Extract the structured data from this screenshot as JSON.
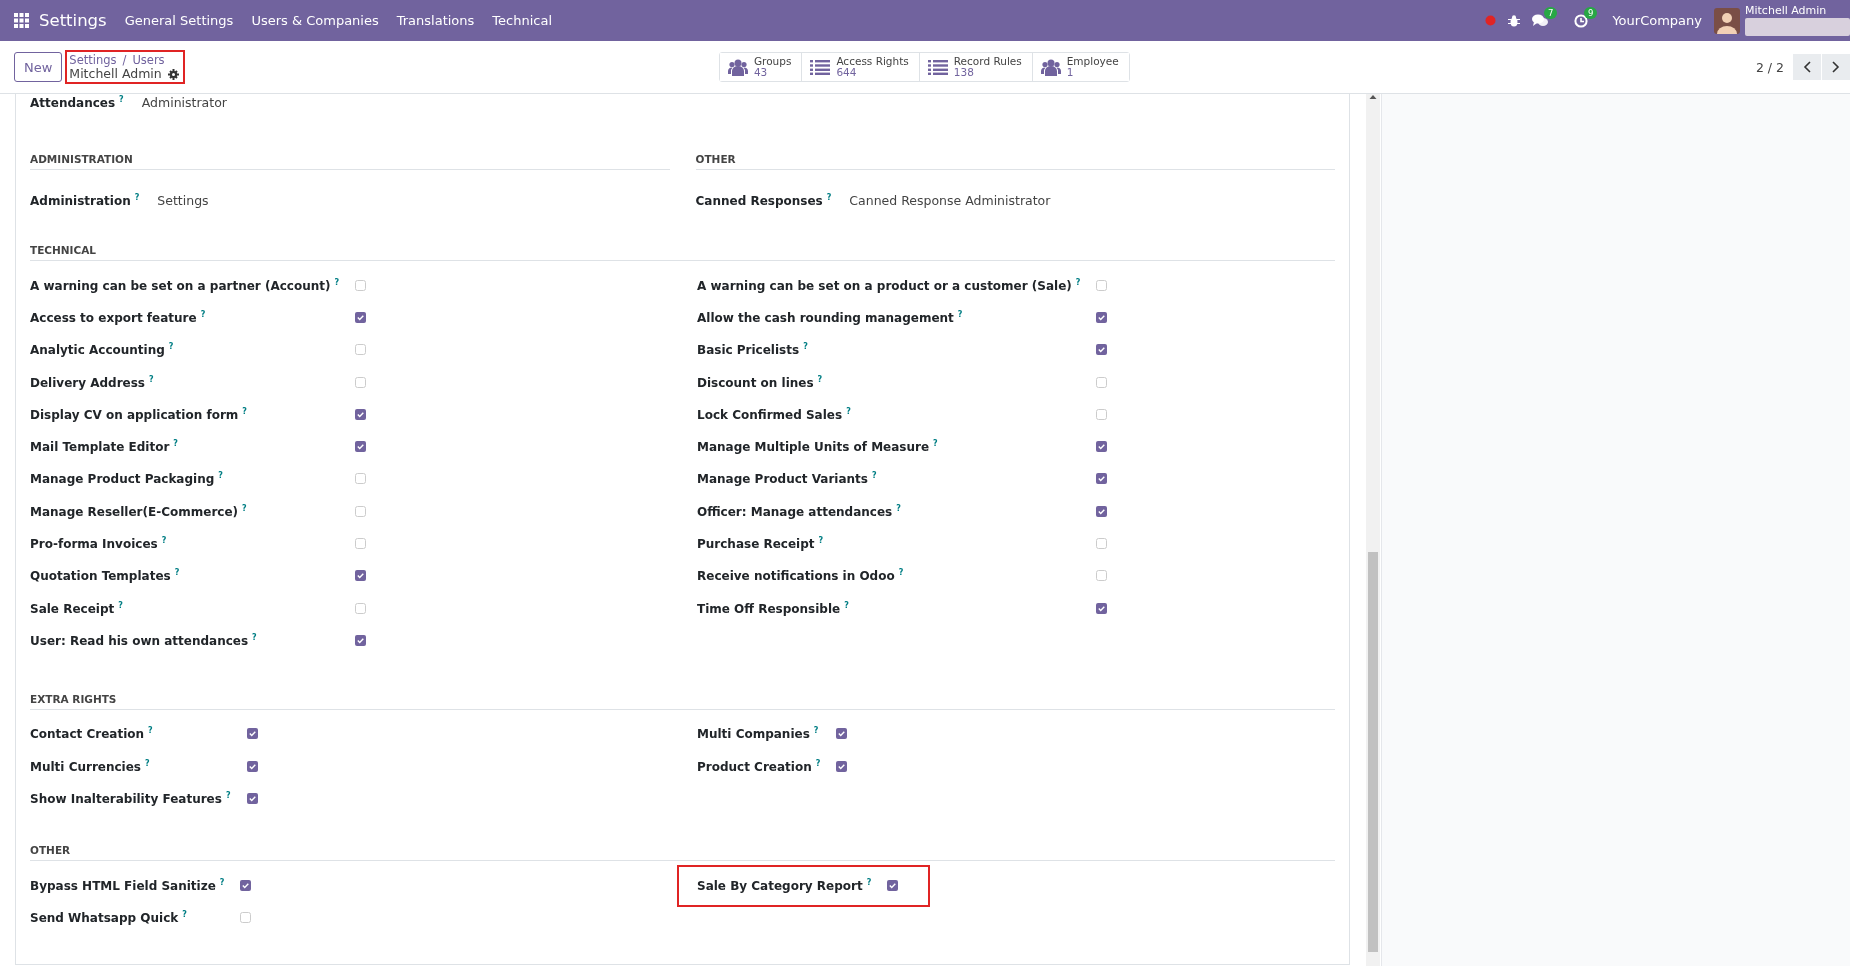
{
  "navbar": {
    "app": "Settings",
    "menus": [
      "General Settings",
      "Users & Companies",
      "Translations",
      "Technical"
    ],
    "chat_badge": "7",
    "activity_badge": "9",
    "company": "YourCompany",
    "user": "Mitchell Admin"
  },
  "control_panel": {
    "new_button": "New",
    "breadcrumb": [
      "Settings",
      "Users"
    ],
    "breadcrumb_separator": "/",
    "current": "Mitchell Admin",
    "highlighted": true,
    "smart_buttons": [
      {
        "kind": "users",
        "label": "Groups",
        "value": "43"
      },
      {
        "kind": "list",
        "label": "Access Rights",
        "value": "644"
      },
      {
        "kind": "list",
        "label": "Record Rules",
        "value": "138"
      },
      {
        "kind": "users",
        "label": "Employee",
        "value": "1"
      }
    ],
    "pager": "2 / 2"
  },
  "top_field": {
    "label": "Attendances",
    "help": "?",
    "value": "Administrator"
  },
  "blocks": [
    {
      "kind": "split",
      "sections": [
        {
          "title": "ADMINISTRATION",
          "fields": [
            {
              "label": "Administration",
              "help": "?",
              "value": "Settings"
            }
          ]
        },
        {
          "title": "OTHER",
          "fields": [
            {
              "label": "Canned Responses",
              "help": "?",
              "value": "Canned Response Administrator"
            }
          ]
        }
      ]
    },
    {
      "kind": "checks",
      "title": "TECHNICAL",
      "columns": [
        [
          {
            "label": "A warning can be set on a partner (Account)",
            "help": "?",
            "checked": false
          },
          {
            "label": "Access to export feature",
            "help": "?",
            "checked": true
          },
          {
            "label": "Analytic Accounting",
            "help": "?",
            "checked": false
          },
          {
            "label": "Delivery Address",
            "help": "?",
            "checked": false
          },
          {
            "label": "Display CV on application form",
            "help": "?",
            "checked": true
          },
          {
            "label": "Mail Template Editor",
            "help": "?",
            "checked": true
          },
          {
            "label": "Manage Product Packaging",
            "help": "?",
            "checked": false
          },
          {
            "label": "Manage Reseller(E-Commerce)",
            "help": "?",
            "checked": false
          },
          {
            "label": "Pro-forma Invoices",
            "help": "?",
            "checked": false
          },
          {
            "label": "Quotation Templates",
            "help": "?",
            "checked": true
          },
          {
            "label": "Sale Receipt",
            "help": "?",
            "checked": false
          },
          {
            "label": "User: Read his own attendances",
            "help": "?",
            "checked": true
          }
        ],
        [
          {
            "label": "A warning can be set on a product or a customer (Sale)",
            "help": "?",
            "checked": false
          },
          {
            "label": "Allow the cash rounding management",
            "help": "?",
            "checked": true
          },
          {
            "label": "Basic Pricelists",
            "help": "?",
            "checked": true
          },
          {
            "label": "Discount on lines",
            "help": "?",
            "checked": false
          },
          {
            "label": "Lock Confirmed Sales",
            "help": "?",
            "checked": false
          },
          {
            "label": "Manage Multiple Units of Measure",
            "help": "?",
            "checked": true
          },
          {
            "label": "Manage Product Variants",
            "help": "?",
            "checked": true
          },
          {
            "label": "Officer: Manage attendances",
            "help": "?",
            "checked": true
          },
          {
            "label": "Purchase Receipt",
            "help": "?",
            "checked": false
          },
          {
            "label": "Receive notifications in Odoo",
            "help": "?",
            "checked": false
          },
          {
            "label": "Time Off Responsible",
            "help": "?",
            "checked": true
          }
        ]
      ]
    },
    {
      "kind": "checks",
      "title": "EXTRA RIGHTS",
      "columns": [
        [
          {
            "label": "Contact Creation",
            "help": "?",
            "checked": true
          },
          {
            "label": "Multi Currencies",
            "help": "?",
            "checked": true
          },
          {
            "label": "Show Inalterability Features",
            "help": "?",
            "checked": true
          }
        ],
        [
          {
            "label": "Multi Companies",
            "help": "?",
            "checked": true
          },
          {
            "label": "Product Creation",
            "help": "?",
            "checked": true
          }
        ]
      ]
    },
    {
      "kind": "checks",
      "title": "OTHER",
      "columns": [
        [
          {
            "label": "Bypass HTML Field Sanitize",
            "help": "?",
            "checked": true
          },
          {
            "label": "Send Whatsapp Quick",
            "help": "?",
            "checked": false
          }
        ],
        [
          {
            "label": "Sale By Category Report",
            "help": "?",
            "checked": true,
            "highlighted": true
          }
        ]
      ]
    }
  ]
}
